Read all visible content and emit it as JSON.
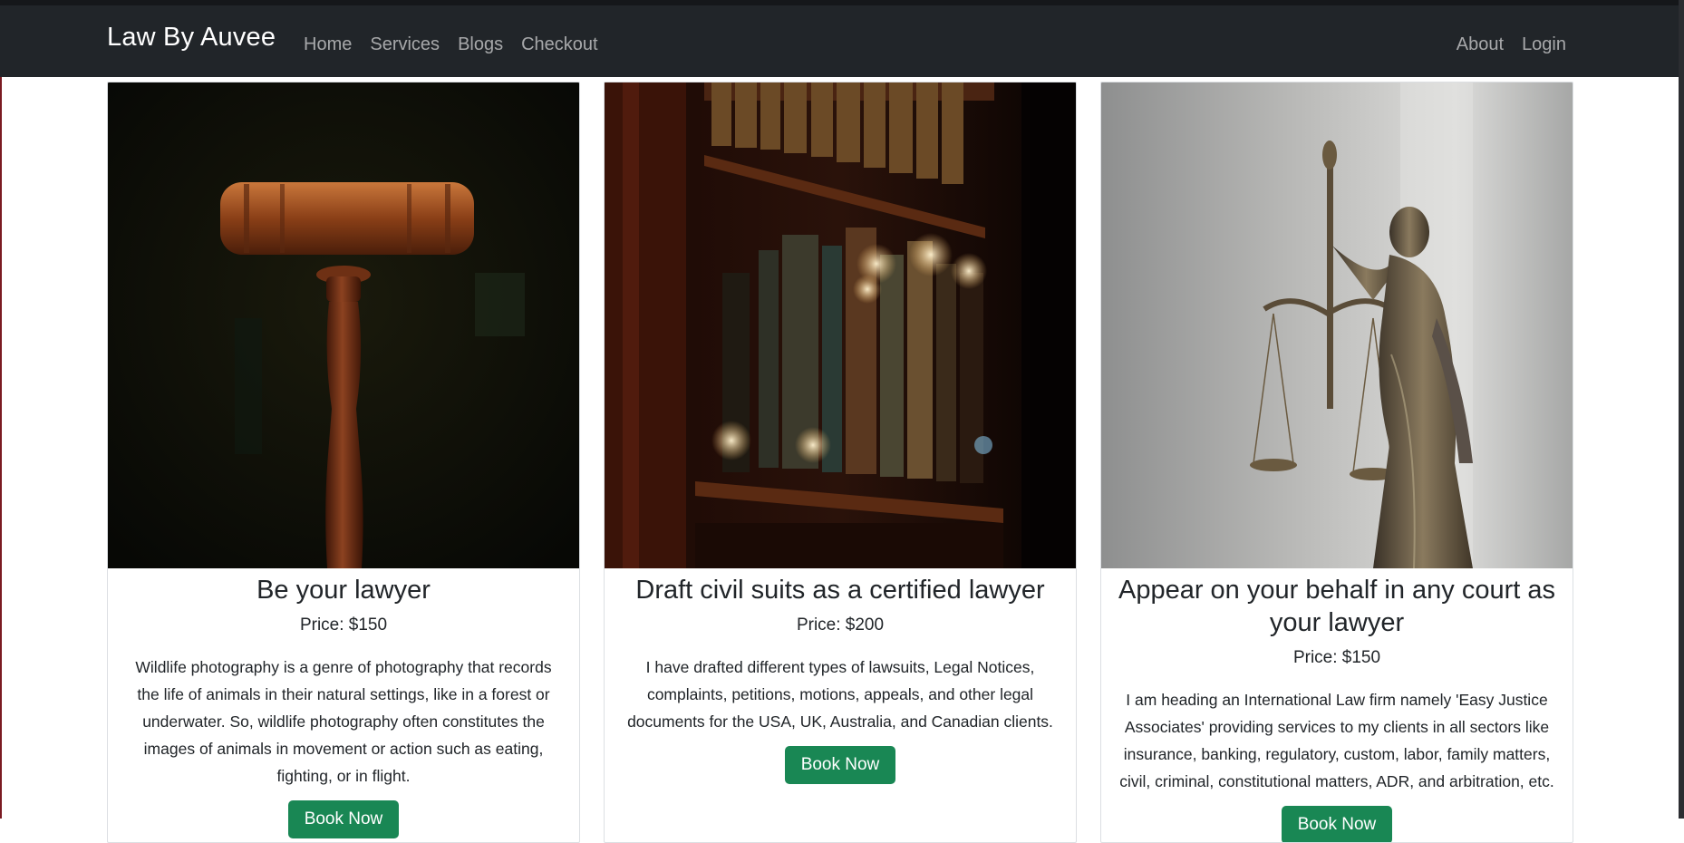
{
  "navbar": {
    "brand": "Law By Auvee",
    "left_links": [
      "Home",
      "Services",
      "Blogs",
      "Checkout"
    ],
    "right_links": [
      "About",
      "Login"
    ]
  },
  "services": [
    {
      "image_icon": "gavel-photo",
      "title": "Be your lawyer",
      "price": "Price: $150",
      "description": "Wildlife photography is a genre of photography that records the life of animals in their natural settings, like in a forest or underwater. So, wildlife photography often constitutes the images of animals in movement or action such as eating, fighting, or in flight.",
      "button": "Book Now"
    },
    {
      "image_icon": "bookshelf-photo",
      "title": "Draft civil suits as a certified lawyer",
      "price": "Price: $200",
      "description": "I have drafted different types of lawsuits, Legal Notices, complaints, petitions, motions, appeals, and other legal documents for the USA, UK, Australia, and Canadian clients.",
      "button": "Book Now"
    },
    {
      "image_icon": "lady-justice-photo",
      "title": "Appear on your behalf in any court as your lawyer",
      "price": "Price: $150",
      "description": "I am heading an International Law firm namely 'Easy Justice Associates' providing services to my clients in all sectors like insurance, banking, regulatory, custom, labor, family matters, civil, criminal, constitutional matters, ADR, and arbitration, etc.",
      "button": "Book Now"
    }
  ],
  "colors": {
    "navbar_bg": "#212529",
    "button_green": "#198754"
  }
}
